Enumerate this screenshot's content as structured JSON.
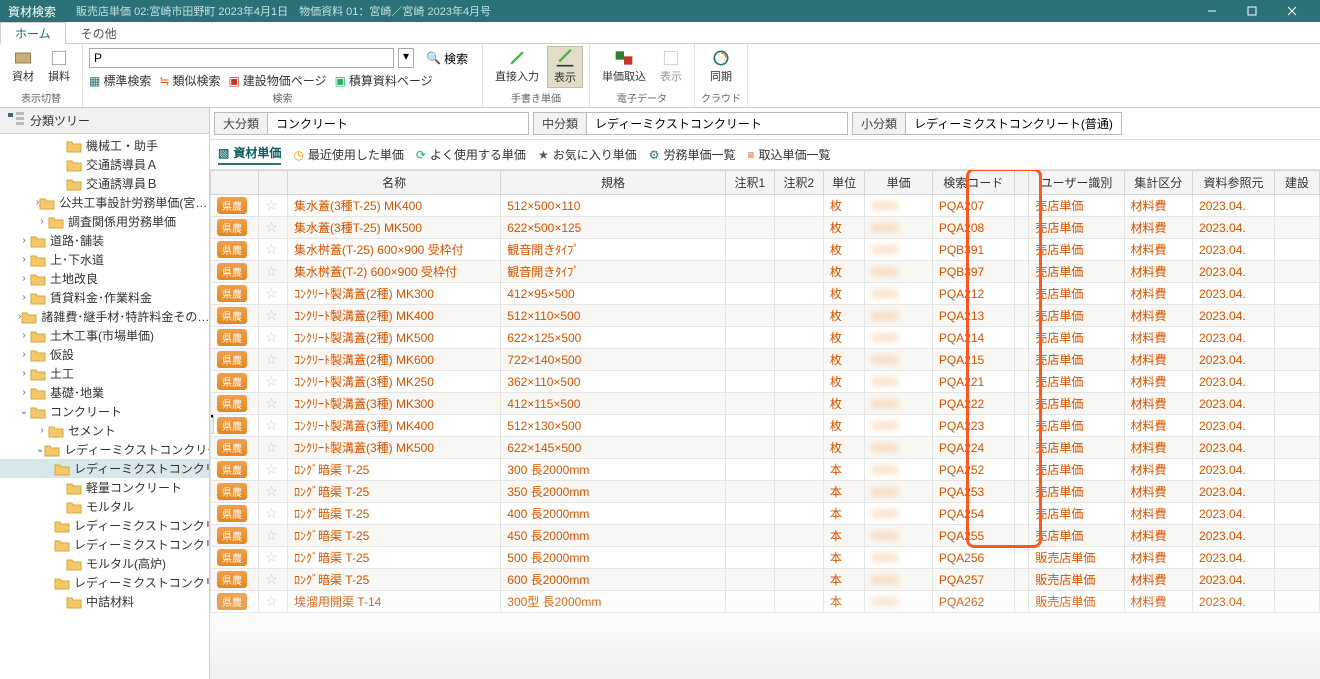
{
  "title_bar": {
    "app": "資材検索",
    "context": "販売店単価 02:宮崎市田野町 2023年4月1日　物価資料 01：宮崎／宮崎 2023年4月号"
  },
  "menu_tabs": {
    "home": "ホーム",
    "other": "その他"
  },
  "ribbon": {
    "group_display": {
      "label": "表示切替",
      "shizai": "資材",
      "sonryo": "損料"
    },
    "group_search": {
      "label": "検索",
      "input": "P",
      "search_btn": "検索",
      "std": "標準検索",
      "similar": "類似検索",
      "price_page": "建設物価ページ",
      "sekizai": "積算資料ページ"
    },
    "group_hand": {
      "label": "手書き単価",
      "direct": "直接入力",
      "show": "表示"
    },
    "group_elec": {
      "label": "電子データ",
      "import": "単価取込",
      "show": "表示"
    },
    "group_cloud": {
      "label": "クラウド",
      "sync": "同期"
    }
  },
  "sidebar": {
    "header": "分類ツリー",
    "items": [
      {
        "label": "機械工・助手",
        "depth": 3,
        "exp": ""
      },
      {
        "label": "交通誘導員Ａ",
        "depth": 3,
        "exp": ""
      },
      {
        "label": "交通誘導員Ｂ",
        "depth": 3,
        "exp": ""
      },
      {
        "label": "公共工事設計労務単価(宮…",
        "depth": 2,
        "exp": "›"
      },
      {
        "label": "調査関係用労務単価",
        "depth": 2,
        "exp": "›"
      },
      {
        "label": "道路･舗装",
        "depth": 1,
        "exp": "›"
      },
      {
        "label": "上･下水道",
        "depth": 1,
        "exp": "›"
      },
      {
        "label": "土地改良",
        "depth": 1,
        "exp": "›"
      },
      {
        "label": "賃貸料金･作業料金",
        "depth": 1,
        "exp": "›"
      },
      {
        "label": "諸雑費･継手材･特許料金その…",
        "depth": 1,
        "exp": "›"
      },
      {
        "label": "土木工事(市場単価)",
        "depth": 1,
        "exp": "›"
      },
      {
        "label": "仮設",
        "depth": 1,
        "exp": "›"
      },
      {
        "label": "土工",
        "depth": 1,
        "exp": "›"
      },
      {
        "label": "基礎･地業",
        "depth": 1,
        "exp": "›"
      },
      {
        "label": "コンクリート",
        "depth": 1,
        "exp": "⌄"
      },
      {
        "label": "セメント",
        "depth": 2,
        "exp": "›"
      },
      {
        "label": "レディーミクストコンクリート",
        "depth": 2,
        "exp": "⌄"
      },
      {
        "label": "レディーミクストコンクリート(普通)",
        "depth": 3,
        "exp": "",
        "sel": true
      },
      {
        "label": "軽量コンクリート",
        "depth": 3,
        "exp": ""
      },
      {
        "label": "モルタル",
        "depth": 3,
        "exp": ""
      },
      {
        "label": "レディーミクストコンクリート(早強)",
        "depth": 3,
        "exp": ""
      },
      {
        "label": "レディーミクストコンクリート(高炉)",
        "depth": 3,
        "exp": ""
      },
      {
        "label": "モルタル(高炉)",
        "depth": 3,
        "exp": ""
      },
      {
        "label": "レディーミクストコンクリート",
        "depth": 3,
        "exp": ""
      },
      {
        "label": "中詰材料",
        "depth": 3,
        "exp": ""
      }
    ]
  },
  "classify": {
    "big_label": "大分類",
    "big_val": "コンクリート",
    "mid_label": "中分類",
    "mid_val": "レディーミクストコンクリート",
    "small_label": "小分類",
    "small_val": "レディーミクストコンクリート(普通)"
  },
  "quick_tabs": {
    "shizai": "資材単価",
    "recent": "最近使用した単価",
    "often": "よく使用する単価",
    "fav": "お気に入り単価",
    "labor": "労務単価一覧",
    "import": "取込単価一覧"
  },
  "table": {
    "headers": {
      "name": "名称",
      "spec": "規格",
      "note1": "注釈1",
      "note2": "注釈2",
      "unit": "単位",
      "price": "単価",
      "code": "検索コード",
      "user": "ユーザー識別",
      "aggr": "集計区分",
      "ref": "資料参照元",
      "build": "建設"
    },
    "badge": "県農",
    "rows": [
      {
        "name": "集水蓋(3種T-25) MK400",
        "spec": "512×500×110",
        "unit": "枚",
        "code": "PQA207",
        "user": "売店単価",
        "aggr": "材料費",
        "ref": "2023.04."
      },
      {
        "name": "集水蓋(3種T-25) MK500",
        "spec": "622×500×125",
        "unit": "枚",
        "code": "PQA208",
        "user": "売店単価",
        "aggr": "材料費",
        "ref": "2023.04."
      },
      {
        "name": "集水桝蓋(T-25) 600×900 受枠付",
        "spec": "観音開きﾀｲﾌﾟ",
        "unit": "枚",
        "code": "PQB391",
        "user": "売店単価",
        "aggr": "材料費",
        "ref": "2023.04."
      },
      {
        "name": "集水桝蓋(T-2) 600×900 受枠付",
        "spec": "観音開きﾀｲﾌﾟ",
        "unit": "枚",
        "code": "PQB397",
        "user": "売店単価",
        "aggr": "材料費",
        "ref": "2023.04."
      },
      {
        "name": "ｺﾝｸﾘｰﾄ製溝蓋(2種) MK300",
        "spec": "412×95×500",
        "unit": "枚",
        "code": "PQA212",
        "user": "売店単価",
        "aggr": "材料費",
        "ref": "2023.04."
      },
      {
        "name": "ｺﾝｸﾘｰﾄ製溝蓋(2種) MK400",
        "spec": "512×110×500",
        "unit": "枚",
        "code": "PQA213",
        "user": "売店単価",
        "aggr": "材料費",
        "ref": "2023.04."
      },
      {
        "name": "ｺﾝｸﾘｰﾄ製溝蓋(2種) MK500",
        "spec": "622×125×500",
        "unit": "枚",
        "code": "PQA214",
        "user": "売店単価",
        "aggr": "材料費",
        "ref": "2023.04."
      },
      {
        "name": "ｺﾝｸﾘｰﾄ製溝蓋(2種) MK600",
        "spec": "722×140×500",
        "unit": "枚",
        "code": "PQA215",
        "user": "売店単価",
        "aggr": "材料費",
        "ref": "2023.04."
      },
      {
        "name": "ｺﾝｸﾘｰﾄ製溝蓋(3種) MK250",
        "spec": "362×110×500",
        "unit": "枚",
        "code": "PQA221",
        "user": "売店単価",
        "aggr": "材料費",
        "ref": "2023.04."
      },
      {
        "name": "ｺﾝｸﾘｰﾄ製溝蓋(3種) MK300",
        "spec": "412×115×500",
        "unit": "枚",
        "code": "PQA222",
        "user": "売店単価",
        "aggr": "材料費",
        "ref": "2023.04."
      },
      {
        "name": "ｺﾝｸﾘｰﾄ製溝蓋(3種) MK400",
        "spec": "512×130×500",
        "unit": "枚",
        "code": "PQA223",
        "user": "売店単価",
        "aggr": "材料費",
        "ref": "2023.04."
      },
      {
        "name": "ｺﾝｸﾘｰﾄ製溝蓋(3種) MK500",
        "spec": "622×145×500",
        "unit": "枚",
        "code": "PQA224",
        "user": "売店単価",
        "aggr": "材料費",
        "ref": "2023.04."
      },
      {
        "name": "ﾛﾝｸﾞ暗渠 T-25",
        "spec": "300 長2000mm",
        "unit": "本",
        "code": "PQA252",
        "user": "売店単価",
        "aggr": "材料費",
        "ref": "2023.04."
      },
      {
        "name": "ﾛﾝｸﾞ暗渠 T-25",
        "spec": "350 長2000mm",
        "unit": "本",
        "code": "PQA253",
        "user": "売店単価",
        "aggr": "材料費",
        "ref": "2023.04."
      },
      {
        "name": "ﾛﾝｸﾞ暗渠 T-25",
        "spec": "400 長2000mm",
        "unit": "本",
        "code": "PQA254",
        "user": "売店単価",
        "aggr": "材料費",
        "ref": "2023.04."
      },
      {
        "name": "ﾛﾝｸﾞ暗渠 T-25",
        "spec": "450 長2000mm",
        "unit": "本",
        "code": "PQA255",
        "user": "売店単価",
        "aggr": "材料費",
        "ref": "2023.04."
      },
      {
        "name": "ﾛﾝｸﾞ暗渠 T-25",
        "spec": "500 長2000mm",
        "unit": "本",
        "code": "PQA256",
        "user": "販売店単価",
        "aggr": "材料費",
        "ref": "2023.04."
      },
      {
        "name": "ﾛﾝｸﾞ暗渠 T-25",
        "spec": "600 長2000mm",
        "unit": "本",
        "code": "PQA257",
        "user": "販売店単価",
        "aggr": "材料費",
        "ref": "2023.04."
      },
      {
        "name": "埃溜用開渠 T-14",
        "spec": "300型 長2000mm",
        "unit": "本",
        "code": "PQA262",
        "user": "販売店単価",
        "aggr": "材料費",
        "ref": "2023.04."
      }
    ]
  }
}
